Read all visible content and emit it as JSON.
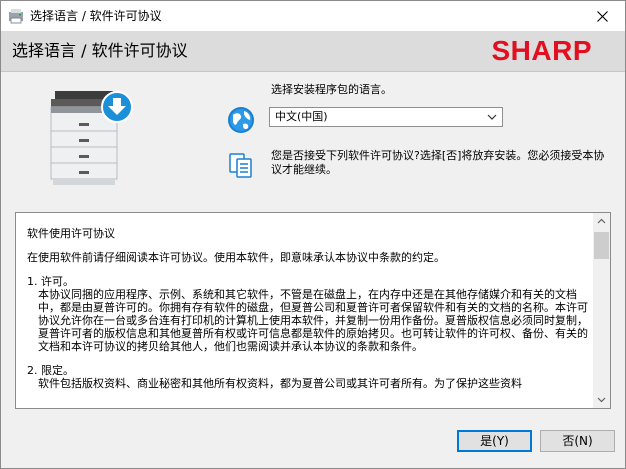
{
  "window": {
    "title": "选择语言 / 软件许可协议"
  },
  "header": {
    "title": "选择语言 / 软件许可协议",
    "brand": "SHARP"
  },
  "language": {
    "prompt": "选择安装程序包的语言。",
    "selected": "中文(中国)"
  },
  "agreement": {
    "prompt": "您是否接受下列软件许可协议?选择[否]将放弃安装。您必须接受本协议才能继续。"
  },
  "license": {
    "title": "软件使用许可协议",
    "intro": "在使用软件前请仔细阅读本许可协议。使用本软件，即意味承认本协议中条款的约定。",
    "sections": [
      {
        "heading": "1. 许可。",
        "body": "本协议同捆的应用程序、示例、系统和其它软件，不管是在磁盘上，在内存中还是在其他存储媒介和有关的文档中，都是由夏普许可的。你拥有存有软件的磁盘，但夏普公司和夏普许可者保留软件和有关的文档的名称。本许可协议允许你在一台或多台连有打印机的计算机上使用本软件，并复制一份用作备份。夏普版权信息必须同时复制，夏普许可者的版权信息和其他夏普所有权或许可信息都是软件的原始拷贝。也可转让软件的许可权、备份、有关的文档和本许可协议的拷贝给其他人，他们也需阅读并承认本协议的条款和条件。"
      },
      {
        "heading": "2. 限定。",
        "body": "软件包括版权资料、商业秘密和其他所有权资料，都为夏普公司或其许可者所有。为了保护这些资料"
      }
    ]
  },
  "buttons": {
    "yes": "是(Y)",
    "no": "否(N)"
  }
}
